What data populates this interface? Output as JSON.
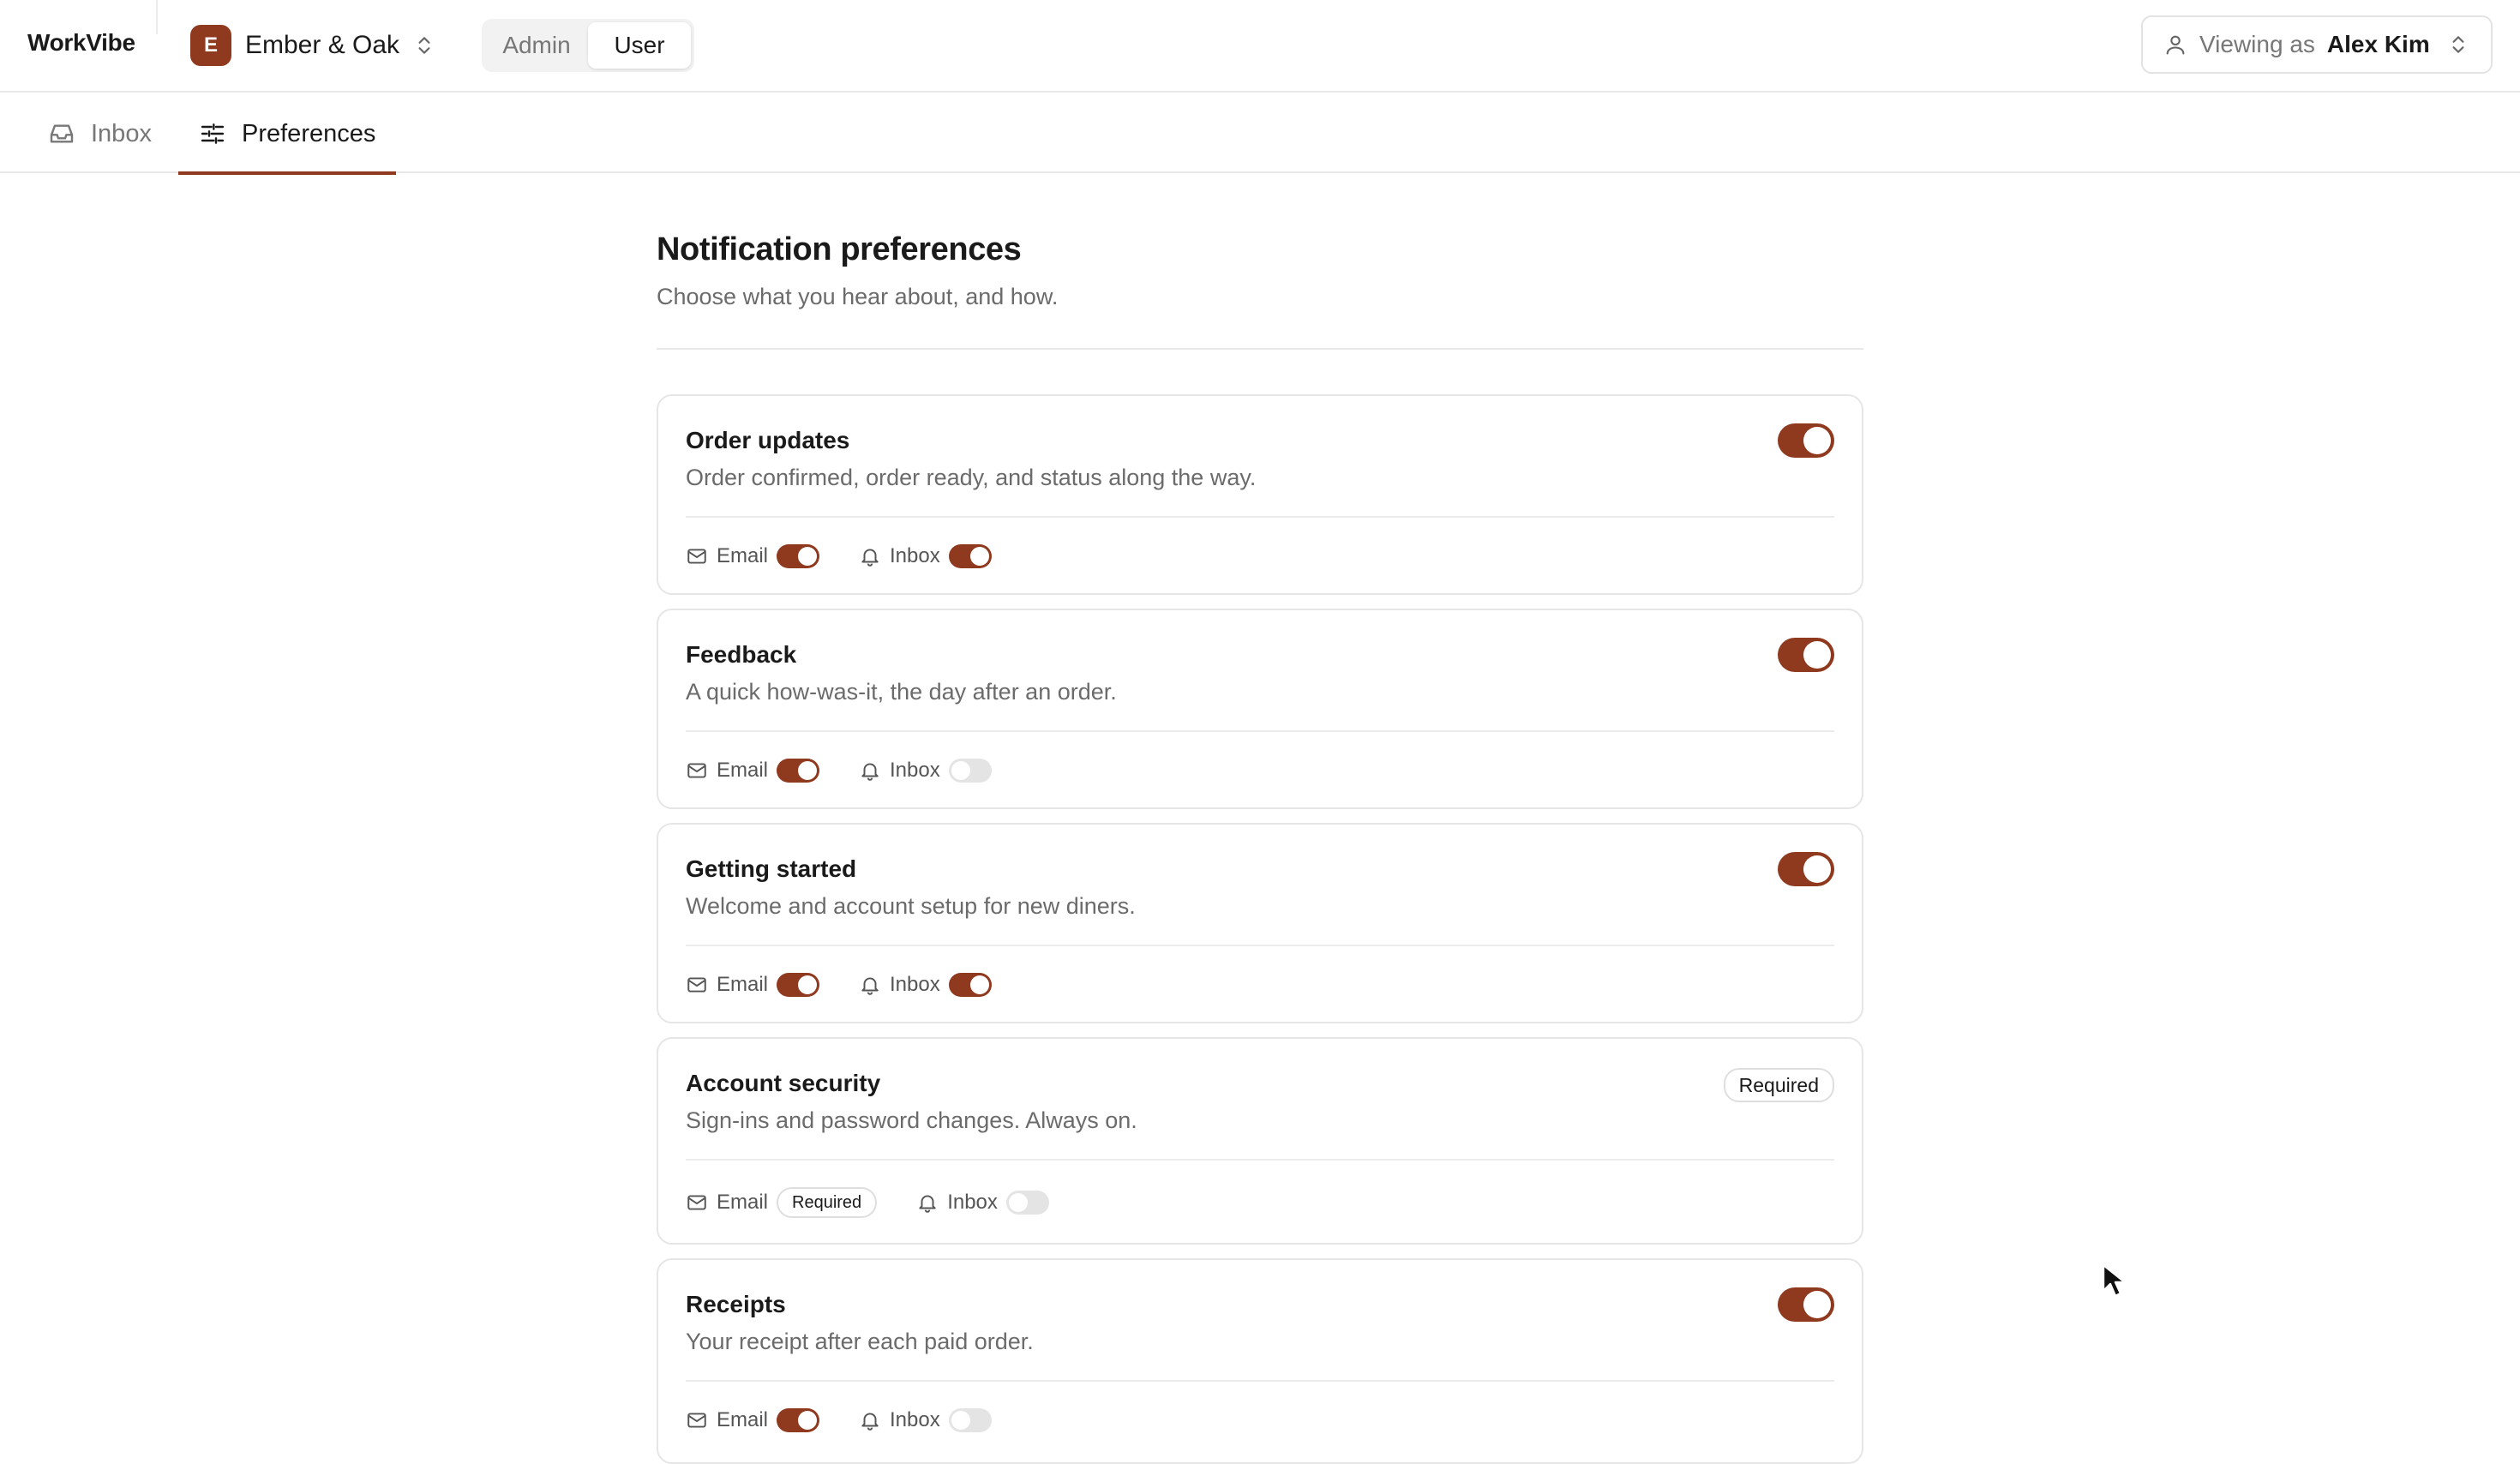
{
  "app": {
    "brand": "WorkVibe"
  },
  "org": {
    "initial": "E",
    "name": "Ember & Oak"
  },
  "role_switch": {
    "options": [
      "Admin",
      "User"
    ],
    "active": "User"
  },
  "viewing": {
    "label": "Viewing as",
    "user": "Alex Kim"
  },
  "tabs": [
    {
      "label": "Inbox",
      "icon": "inbox-icon",
      "active": false
    },
    {
      "label": "Preferences",
      "icon": "sliders-icon",
      "active": true
    }
  ],
  "page": {
    "title": "Notification preferences",
    "subtitle": "Choose what you hear about, and how."
  },
  "categories": [
    {
      "title": "Order updates",
      "description": "Order confirmed, order ready, and status along the way.",
      "enabled": true,
      "required": false,
      "email": true,
      "inbox": true
    },
    {
      "title": "Feedback",
      "description": "A quick how-was-it, the day after an order.",
      "enabled": true,
      "required": false,
      "email": true,
      "inbox": false
    },
    {
      "title": "Getting started",
      "description": "Welcome and account setup for new diners.",
      "enabled": true,
      "required": false,
      "email": true,
      "inbox": true
    },
    {
      "title": "Account security",
      "description": "Sign-ins and password changes. Always on.",
      "enabled": true,
      "required": true,
      "email": "required",
      "inbox": false
    },
    {
      "title": "Receipts",
      "description": "Your receipt after each paid order.",
      "enabled": true,
      "required": false,
      "email": true,
      "inbox": false
    }
  ],
  "labels": {
    "email": "Email",
    "inbox": "Inbox",
    "required": "Required"
  },
  "colors": {
    "accent": "#8f3a1e",
    "toggle_off": "#e4e4e4",
    "muted_text": "#6b6b6b",
    "border": "#e6e6e6"
  }
}
